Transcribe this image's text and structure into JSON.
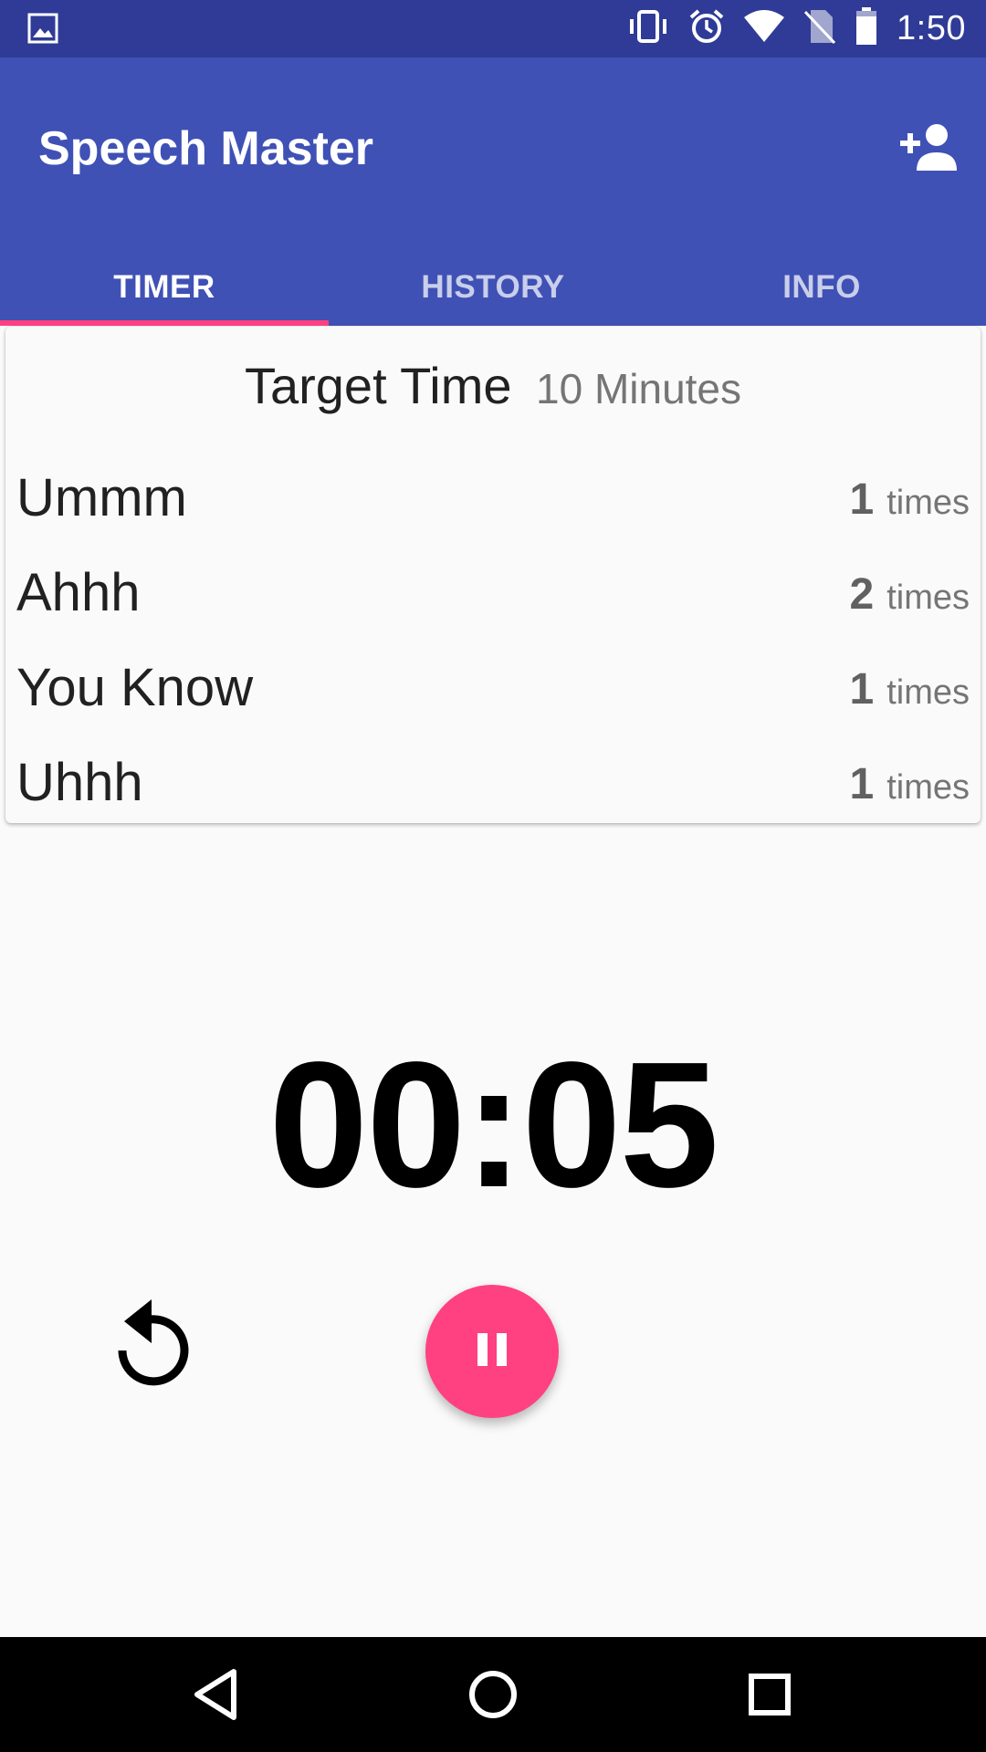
{
  "status_bar": {
    "time": "1:50",
    "icons": [
      "image-notification-icon",
      "vibrate-icon",
      "alarm-icon",
      "wifi-icon",
      "no-sim-icon",
      "battery-icon"
    ]
  },
  "app_bar": {
    "title": "Speech Master",
    "action_icon": "add-person-icon"
  },
  "tabs": [
    {
      "label": "TIMER",
      "active": true
    },
    {
      "label": "HISTORY",
      "active": false
    },
    {
      "label": "INFO",
      "active": false
    }
  ],
  "target": {
    "label": "Target Time",
    "value": "10 Minutes"
  },
  "fillers": [
    {
      "word": "Ummm",
      "count": "1",
      "unit": "times"
    },
    {
      "word": "Ahhh",
      "count": "2",
      "unit": "times"
    },
    {
      "word": "You Know",
      "count": "1",
      "unit": "times"
    },
    {
      "word": "Uhhh",
      "count": "1",
      "unit": "times"
    }
  ],
  "timer": {
    "display": "00:05"
  },
  "controls": {
    "reset_icon": "reset-icon",
    "pause_icon": "pause-icon"
  },
  "colors": {
    "status_bar": "#2f3b96",
    "primary": "#3f51b5",
    "accent": "#ff4081",
    "background": "#fafafa",
    "nav_bar": "#000000"
  },
  "nav": [
    "back-icon",
    "home-icon",
    "recents-icon"
  ]
}
